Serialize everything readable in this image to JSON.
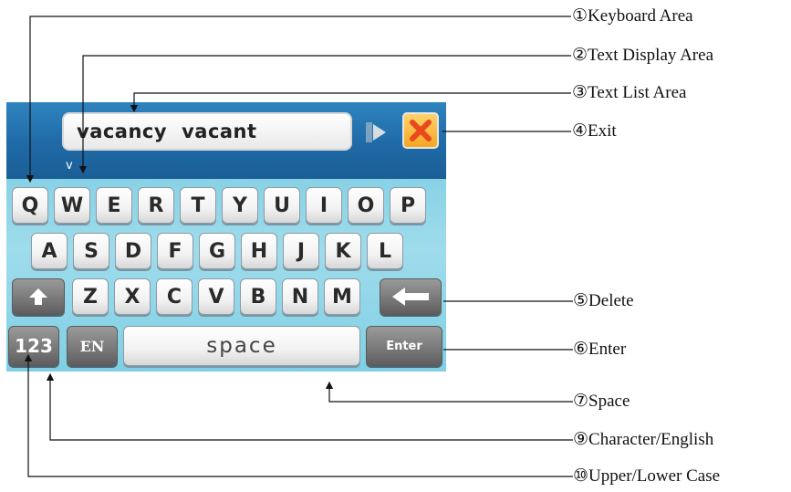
{
  "keyboard": {
    "text_list": {
      "word1": "vacancy",
      "word2": "vacant"
    },
    "typed_input": "v",
    "rows": [
      [
        "Q",
        "W",
        "E",
        "R",
        "T",
        "Y",
        "U",
        "I",
        "O",
        "P"
      ],
      [
        "A",
        "S",
        "D",
        "F",
        "G",
        "H",
        "J",
        "K",
        "L"
      ],
      [
        "Z",
        "X",
        "C",
        "V",
        "B",
        "N",
        "M"
      ]
    ],
    "mode_key": "123",
    "lang_key": "EN",
    "space_key": "space",
    "enter_key": "Enter",
    "colors": {
      "topbar": "#1f6aa6",
      "keyboard_bg": "#8fd6ea",
      "exit_button": "#f5a623",
      "exit_x": "#e8491d"
    }
  },
  "callouts": [
    {
      "id": "keyboard-area",
      "label": "①Keyboard Area"
    },
    {
      "id": "text-display-area",
      "label": "②Text Display Area"
    },
    {
      "id": "text-list-area",
      "label": "③Text List Area"
    },
    {
      "id": "exit",
      "label": "④Exit"
    },
    {
      "id": "delete",
      "label": "⑤Delete"
    },
    {
      "id": "enter",
      "label": "⑥Enter"
    },
    {
      "id": "space",
      "label": "⑦Space"
    },
    {
      "id": "character-english",
      "label": "⑨Character/English"
    },
    {
      "id": "upper-lower-case",
      "label": "⑩Upper/Lower Case"
    }
  ]
}
